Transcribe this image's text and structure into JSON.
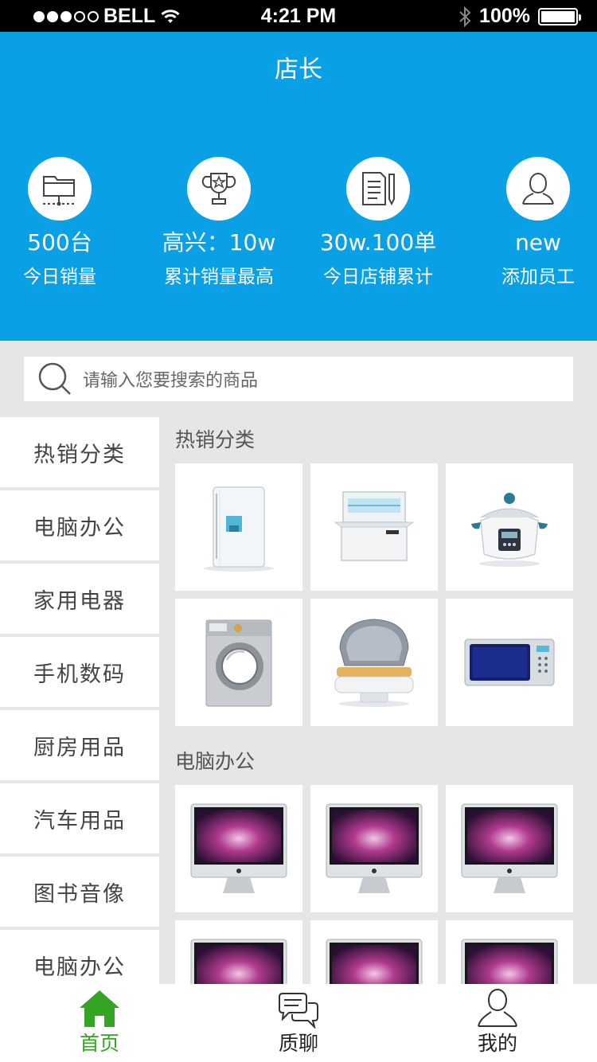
{
  "status_bar": {
    "carrier": "BELL",
    "time": "4:21 PM",
    "battery": "100%"
  },
  "header": {
    "title": "店长"
  },
  "stats": [
    {
      "icon": "folder-icon",
      "value": "500台",
      "label": "今日销量"
    },
    {
      "icon": "trophy-icon",
      "value": "高兴：10w",
      "label": "累计销量最高"
    },
    {
      "icon": "document-pencil-icon",
      "value": "30w.100单",
      "label": "今日店铺累计"
    },
    {
      "icon": "user-icon",
      "value": "new",
      "label": "添加员工"
    }
  ],
  "search": {
    "placeholder": "请输入您要搜索的商品"
  },
  "sidebar": {
    "items": [
      {
        "label": "热销分类"
      },
      {
        "label": "电脑办公"
      },
      {
        "label": "家用电器"
      },
      {
        "label": "手机数码"
      },
      {
        "label": "厨房用品"
      },
      {
        "label": "汽车用品"
      },
      {
        "label": "图书音像"
      },
      {
        "label": "电脑办公"
      }
    ]
  },
  "sections": [
    {
      "title": "热销分类",
      "products": [
        "refrigerator-icon",
        "dishwasher-icon",
        "slow-cooker-icon",
        "washing-machine-icon",
        "waffle-maker-icon",
        "microwave-icon"
      ]
    },
    {
      "title": "电脑办公",
      "products": [
        "imac-icon",
        "imac-icon",
        "imac-icon",
        "imac-icon",
        "imac-icon",
        "imac-icon"
      ]
    }
  ],
  "tabbar": {
    "tabs": [
      {
        "label": "首页",
        "icon": "home-icon",
        "active": true
      },
      {
        "label": "质聊",
        "icon": "chat-bubbles-icon",
        "active": false
      },
      {
        "label": "我的",
        "icon": "profile-icon",
        "active": false
      }
    ]
  },
  "colors": {
    "header_bg": "#0aa0e6",
    "active_tab": "#34a523",
    "page_bg": "#e6e6e6"
  }
}
